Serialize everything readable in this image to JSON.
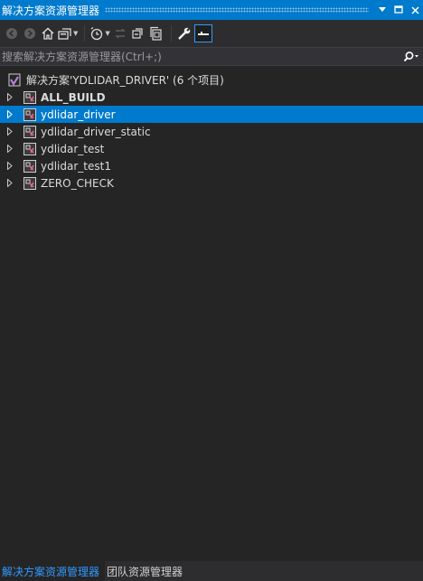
{
  "titlebar": {
    "title": "解决方案资源管理器",
    "dropdown_icon": "▾",
    "pin_icon": "🞏",
    "close_icon": "✕"
  },
  "toolbar": {
    "buttons": [
      "back",
      "forward",
      "home",
      "switch-views",
      "pending-changes-filter",
      "sync-with-active-document",
      "collapse-all",
      "show-all-files",
      "properties",
      "preview-selected-items"
    ]
  },
  "search": {
    "placeholder": "搜索解决方案资源管理器(Ctrl+;)",
    "value": ""
  },
  "tree": {
    "solution": "解决方案'YDLIDAR_DRIVER' (6 个项目)",
    "items": [
      {
        "label": "ALL_BUILD"
      },
      {
        "label": "ydlidar_driver"
      },
      {
        "label": "ydlidar_driver_static"
      },
      {
        "label": "ydlidar_test"
      },
      {
        "label": "ydlidar_test1"
      },
      {
        "label": "ZERO_CHECK"
      }
    ]
  },
  "tabs": [
    {
      "label": "解决方案资源管理器"
    },
    {
      "label": "团队资源管理器"
    }
  ],
  "colors": {
    "accent": "#007acc",
    "background": "#252526",
    "selected": "#007acc"
  }
}
